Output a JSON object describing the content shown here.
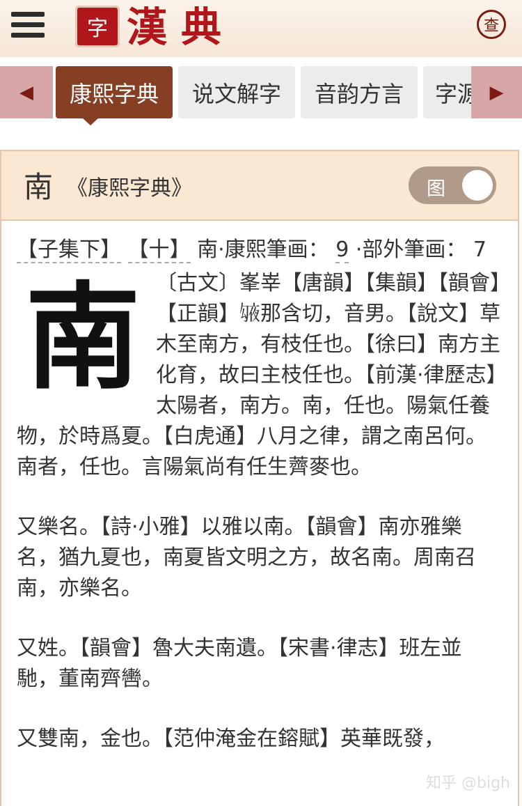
{
  "header": {
    "seal_text": "字",
    "logo_text": "漢典",
    "search_label": "查"
  },
  "tabs": [
    {
      "label": "康熙字典",
      "active": true
    },
    {
      "label": "说文解字",
      "active": false
    },
    {
      "label": "音韵方言",
      "active": false
    },
    {
      "label": "字源",
      "active": false
    }
  ],
  "card": {
    "head_char": "南",
    "head_title": "《康熙字典》",
    "toggle_label": "图",
    "meta_set": "【子集下】",
    "meta_radical": "【十】",
    "meta_strokes_label": "南·康熙筆画：",
    "meta_strokes": "9",
    "meta_outer_label": "·部外筆画：",
    "meta_outer": "7",
    "big_char": "南",
    "para1": "〔古文〕峯峷【唐韻】【集韻】【韻會】【正韻】𠅱那含切，音男。【說文】草木至南方，有枝任也。【徐曰】南方主化育，故曰主枝任也。【前漢·律歷志】太陽者，南方。南，任也。陽氣任養物，於時爲夏。【白虎通】八月之律，謂之南呂何。南者，任也。言陽氣尚有任生薺麥也。",
    "para2": "又樂名。【詩·小雅】以雅以南。【韻會】南亦雅樂名，猶九夏也，南夏皆文明之方，故名南。周南召南，亦樂名。",
    "para3": "又姓。【韻會】魯大夫南遺。【宋書·律志】班左並馳，董南齊轡。",
    "para4": "又雙南，金也。【范仲淹金在鎔賦】英華既發，"
  },
  "watermark": "知乎 @bigh",
  "colors": {
    "active_tab": "#873f24",
    "card_head": "#fbe8d3",
    "logo_red": "#b0161a"
  }
}
